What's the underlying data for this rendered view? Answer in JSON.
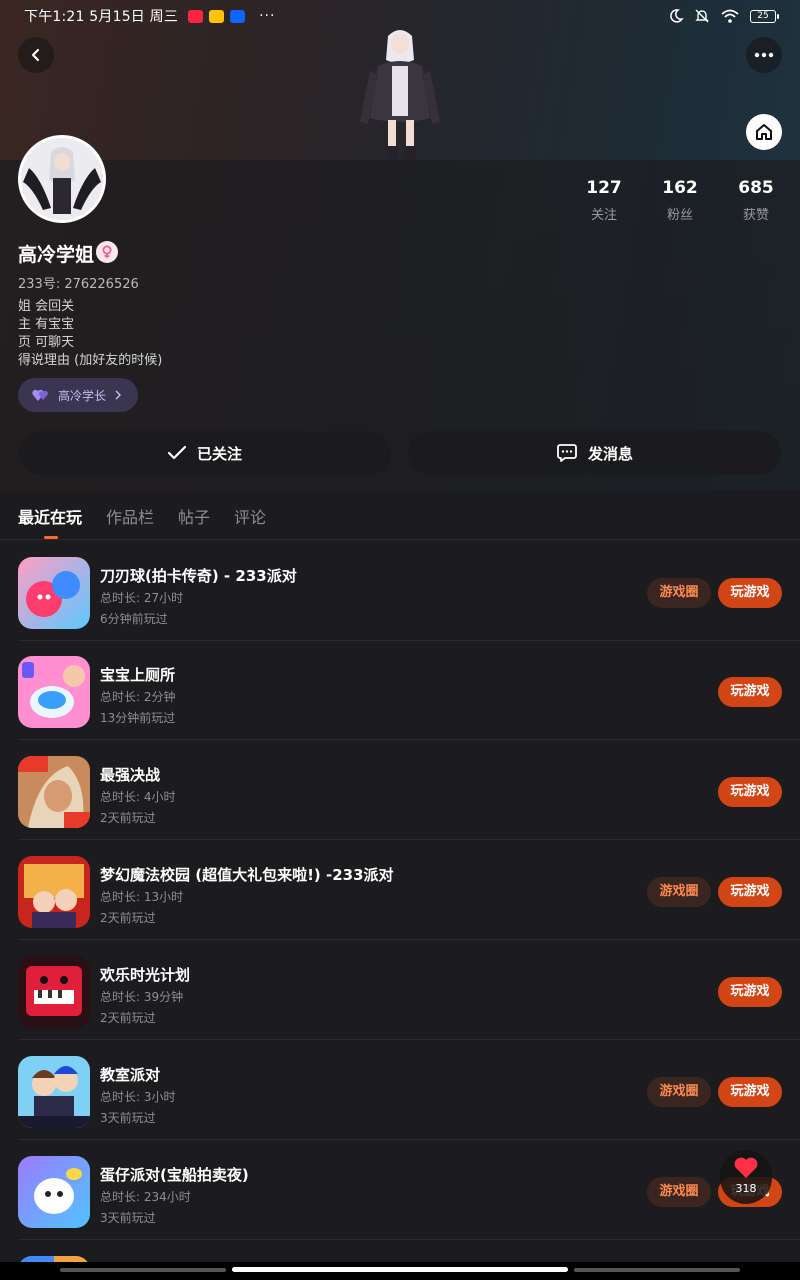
{
  "status_bar": {
    "time": "下午1:21 5月15日 周三",
    "dots": "···",
    "battery": "25",
    "mini_apps": [
      "小红书",
      "美团",
      "知乎"
    ]
  },
  "profile": {
    "username": "高冷学姐",
    "uid": "233号: 276226526",
    "bio": [
      "姐 会回关",
      "主 有宝宝",
      "页 可聊天",
      "得说理由 (加好友的时候)"
    ],
    "tag_label": "高冷学长",
    "stats": [
      {
        "num": "127",
        "label": "关注"
      },
      {
        "num": "162",
        "label": "粉丝"
      },
      {
        "num": "685",
        "label": "获赞"
      }
    ],
    "follow_label": "已关注",
    "message_label": "发消息"
  },
  "tabs": [
    "最近在玩",
    "作品栏",
    "帖子",
    "评论"
  ],
  "active_tab": 0,
  "games": [
    {
      "name": "刀刃球(拍卡传奇) - 233派对",
      "duration": "总时长: 27小时",
      "last": "6分钟前玩过",
      "circle": true,
      "icon": "blade-ball-icon"
    },
    {
      "name": "宝宝上厕所",
      "duration": "总时长: 2分钟",
      "last": "13分钟前玩过",
      "circle": false,
      "icon": "toilet-game-icon"
    },
    {
      "name": "最强决战",
      "duration": "总时长: 4小时",
      "last": "2天前玩过",
      "circle": false,
      "icon": "battle-game-icon"
    },
    {
      "name": "梦幻魔法校园 (超值大礼包来啦!) -233派对",
      "duration": "总时长: 13小时",
      "last": "2天前玩过",
      "circle": true,
      "icon": "magic-school-icon"
    },
    {
      "name": "欢乐时光计划",
      "duration": "总时长: 39分钟",
      "last": "2天前玩过",
      "circle": false,
      "icon": "happy-time-icon"
    },
    {
      "name": "教室派对",
      "duration": "总时长: 3小时",
      "last": "3天前玩过",
      "circle": true,
      "icon": "classroom-party-icon"
    },
    {
      "name": "蛋仔派对(宝船拍卖夜)",
      "duration": "总时长: 234小时",
      "last": "3天前玩过",
      "circle": true,
      "icon": "egg-party-icon"
    }
  ],
  "buttons": {
    "circle_label": "游戏圈",
    "play_label": "玩游戏"
  },
  "like_float": {
    "count": "318"
  },
  "colors": {
    "accent": "#d24515",
    "circle_text": "#ff8a50",
    "background": "#1c1c1e"
  }
}
